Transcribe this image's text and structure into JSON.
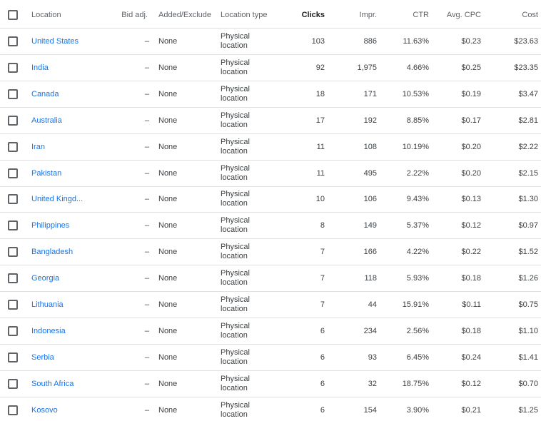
{
  "header": {
    "location": "Location",
    "bid_adj": "Bid adj.",
    "added_exclude": "Added/Exclude",
    "location_type": "Location type",
    "clicks": "Clicks",
    "impr": "Impr.",
    "ctr": "CTR",
    "avg_cpc": "Avg. CPC",
    "cost": "Cost"
  },
  "rows": [
    {
      "location": "United States",
      "bid_adj": "–",
      "added_exclude": "None",
      "location_type": "Physical location",
      "clicks": "103",
      "impr": "886",
      "ctr": "11.63%",
      "avg_cpc": "$0.23",
      "cost": "$23.63"
    },
    {
      "location": "India",
      "bid_adj": "–",
      "added_exclude": "None",
      "location_type": "Physical location",
      "clicks": "92",
      "impr": "1,975",
      "ctr": "4.66%",
      "avg_cpc": "$0.25",
      "cost": "$23.35"
    },
    {
      "location": "Canada",
      "bid_adj": "–",
      "added_exclude": "None",
      "location_type": "Physical location",
      "clicks": "18",
      "impr": "171",
      "ctr": "10.53%",
      "avg_cpc": "$0.19",
      "cost": "$3.47"
    },
    {
      "location": "Australia",
      "bid_adj": "–",
      "added_exclude": "None",
      "location_type": "Physical location",
      "clicks": "17",
      "impr": "192",
      "ctr": "8.85%",
      "avg_cpc": "$0.17",
      "cost": "$2.81"
    },
    {
      "location": "Iran",
      "bid_adj": "–",
      "added_exclude": "None",
      "location_type": "Physical location",
      "clicks": "11",
      "impr": "108",
      "ctr": "10.19%",
      "avg_cpc": "$0.20",
      "cost": "$2.22"
    },
    {
      "location": "Pakistan",
      "bid_adj": "–",
      "added_exclude": "None",
      "location_type": "Physical location",
      "clicks": "11",
      "impr": "495",
      "ctr": "2.22%",
      "avg_cpc": "$0.20",
      "cost": "$2.15"
    },
    {
      "location": "United Kingd...",
      "bid_adj": "–",
      "added_exclude": "None",
      "location_type": "Physical location",
      "clicks": "10",
      "impr": "106",
      "ctr": "9.43%",
      "avg_cpc": "$0.13",
      "cost": "$1.30"
    },
    {
      "location": "Philippines",
      "bid_adj": "–",
      "added_exclude": "None",
      "location_type": "Physical location",
      "clicks": "8",
      "impr": "149",
      "ctr": "5.37%",
      "avg_cpc": "$0.12",
      "cost": "$0.97"
    },
    {
      "location": "Bangladesh",
      "bid_adj": "–",
      "added_exclude": "None",
      "location_type": "Physical location",
      "clicks": "7",
      "impr": "166",
      "ctr": "4.22%",
      "avg_cpc": "$0.22",
      "cost": "$1.52"
    },
    {
      "location": "Georgia",
      "bid_adj": "–",
      "added_exclude": "None",
      "location_type": "Physical location",
      "clicks": "7",
      "impr": "118",
      "ctr": "5.93%",
      "avg_cpc": "$0.18",
      "cost": "$1.26"
    },
    {
      "location": "Lithuania",
      "bid_adj": "–",
      "added_exclude": "None",
      "location_type": "Physical location",
      "clicks": "7",
      "impr": "44",
      "ctr": "15.91%",
      "avg_cpc": "$0.11",
      "cost": "$0.75"
    },
    {
      "location": "Indonesia",
      "bid_adj": "–",
      "added_exclude": "None",
      "location_type": "Physical location",
      "clicks": "6",
      "impr": "234",
      "ctr": "2.56%",
      "avg_cpc": "$0.18",
      "cost": "$1.10"
    },
    {
      "location": "Serbia",
      "bid_adj": "–",
      "added_exclude": "None",
      "location_type": "Physical location",
      "clicks": "6",
      "impr": "93",
      "ctr": "6.45%",
      "avg_cpc": "$0.24",
      "cost": "$1.41"
    },
    {
      "location": "South Africa",
      "bid_adj": "–",
      "added_exclude": "None",
      "location_type": "Physical location",
      "clicks": "6",
      "impr": "32",
      "ctr": "18.75%",
      "avg_cpc": "$0.12",
      "cost": "$0.70"
    },
    {
      "location": "Kosovo",
      "bid_adj": "–",
      "added_exclude": "None",
      "location_type": "Physical location",
      "clicks": "6",
      "impr": "154",
      "ctr": "3.90%",
      "avg_cpc": "$0.21",
      "cost": "$1.25"
    }
  ]
}
